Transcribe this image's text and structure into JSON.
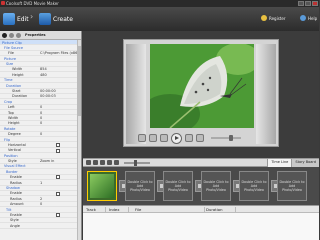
{
  "window": {
    "title": "Coolsoft DVD Movie Maker"
  },
  "toolbar": {
    "edit_label": "Edit",
    "create_label": "Create",
    "register_label": "Register",
    "help_label": "Help"
  },
  "properties": {
    "tab_label": "Properties",
    "rows": [
      {
        "label": "Picture Clip",
        "indent": 0,
        "cat": true
      },
      {
        "label": "File Source",
        "indent": 2,
        "cat": true
      },
      {
        "label": "File",
        "indent": 6,
        "value": "C:\\Program Files (x86)"
      },
      {
        "label": "Picture",
        "indent": 2,
        "cat": true
      },
      {
        "label": "Size",
        "indent": 4,
        "cat": true
      },
      {
        "label": "Width",
        "indent": 10,
        "value": "854"
      },
      {
        "label": "Height",
        "indent": 10,
        "value": "480"
      },
      {
        "label": "Time",
        "indent": 2,
        "cat": true
      },
      {
        "label": "Duration",
        "indent": 4,
        "cat": true
      },
      {
        "label": "Start",
        "indent": 10,
        "value": "00:00:00"
      },
      {
        "label": "Duration",
        "indent": 10,
        "value": "00:00:03"
      },
      {
        "label": "Crop",
        "indent": 2,
        "cat": true
      },
      {
        "label": "Left",
        "indent": 6,
        "value": "0"
      },
      {
        "label": "Top",
        "indent": 6,
        "value": "0"
      },
      {
        "label": "Width",
        "indent": 6,
        "value": "0"
      },
      {
        "label": "Height",
        "indent": 6,
        "value": "0"
      },
      {
        "label": "Rotate",
        "indent": 2,
        "cat": true
      },
      {
        "label": "Degree",
        "indent": 6,
        "value": "0"
      },
      {
        "label": "Flip",
        "indent": 2,
        "cat": true
      },
      {
        "label": "Horizontal",
        "indent": 6,
        "check": true
      },
      {
        "label": "Vertical",
        "indent": 6,
        "check": true
      },
      {
        "label": "Position",
        "indent": 2,
        "cat": true
      },
      {
        "label": "Style",
        "indent": 6,
        "value": "Zoom in"
      },
      {
        "label": "Visual Effect",
        "indent": 2,
        "cat": true
      },
      {
        "label": "Border",
        "indent": 4,
        "cat": true
      },
      {
        "label": "Enable",
        "indent": 8,
        "check": true
      },
      {
        "label": "Radius",
        "indent": 8,
        "value": "1"
      },
      {
        "label": "Shadow",
        "indent": 4,
        "cat": true
      },
      {
        "label": "Enable",
        "indent": 8,
        "check": true
      },
      {
        "label": "Radius",
        "indent": 8,
        "value": "2"
      },
      {
        "label": "Amount",
        "indent": 8,
        "value": "0"
      },
      {
        "label": "Tilt",
        "indent": 4,
        "cat": true
      },
      {
        "label": "Enable",
        "indent": 8,
        "check": true
      },
      {
        "label": "Style",
        "indent": 8,
        "value": ""
      },
      {
        "label": "Angle",
        "indent": 8,
        "value": ""
      }
    ]
  },
  "timeline": {
    "tabs": [
      "Time Line",
      "Story Board"
    ],
    "placeholder": "Double Click to Add Photo/Video",
    "audio_headers": [
      "Track",
      "Index",
      "File",
      "Duration"
    ]
  },
  "colors": {
    "accent": "#ffcc00",
    "titlebar": "#2a2a2a"
  }
}
